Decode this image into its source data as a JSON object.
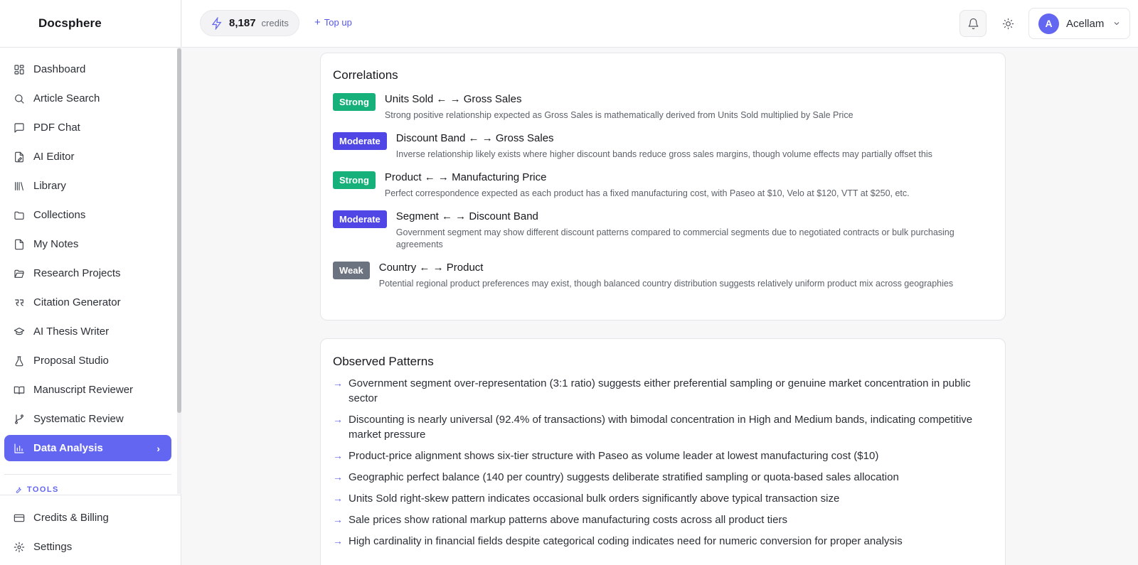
{
  "brand": "Docsphere",
  "sidebar": {
    "items": [
      {
        "label": "Dashboard",
        "icon": "dashboard-icon"
      },
      {
        "label": "Article Search",
        "icon": "search-icon"
      },
      {
        "label": "PDF Chat",
        "icon": "chat-icon"
      },
      {
        "label": "AI Editor",
        "icon": "edit-file-icon"
      },
      {
        "label": "Library",
        "icon": "library-icon"
      },
      {
        "label": "Collections",
        "icon": "folder-icon"
      },
      {
        "label": "My Notes",
        "icon": "note-icon"
      },
      {
        "label": "Research Projects",
        "icon": "folder-open-icon"
      },
      {
        "label": "Citation Generator",
        "icon": "quote-icon"
      },
      {
        "label": "AI Thesis Writer",
        "icon": "graduation-cap-icon"
      },
      {
        "label": "Proposal Studio",
        "icon": "flask-icon"
      },
      {
        "label": "Manuscript Reviewer",
        "icon": "book-open-icon"
      },
      {
        "label": "Systematic Review",
        "icon": "git-branch-icon"
      },
      {
        "label": "Data Analysis",
        "icon": "bar-chart-icon",
        "active": true
      }
    ],
    "tools_label": "TOOLS",
    "bottom_items": [
      {
        "label": "Credits & Billing",
        "icon": "credit-card-icon"
      },
      {
        "label": "Settings",
        "icon": "gear-icon"
      }
    ]
  },
  "topbar": {
    "credits_value": "8,187",
    "credits_unit": "credits",
    "topup_label": "Top up",
    "user_initial": "A",
    "user_name": "Acellam"
  },
  "correlations": {
    "title": "Correlations",
    "items": [
      {
        "strength": "Strong",
        "pair": "Units Sold ← → Gross Sales",
        "desc": "Strong positive relationship expected as Gross Sales is mathematically derived from Units Sold multiplied by Sale Price"
      },
      {
        "strength": "Moderate",
        "pair": "Discount Band ← → Gross Sales",
        "desc": "Inverse relationship likely exists where higher discount bands reduce gross sales margins, though volume effects may partially offset this"
      },
      {
        "strength": "Strong",
        "pair": "Product ← → Manufacturing Price",
        "desc": "Perfect correspondence expected as each product has a fixed manufacturing cost, with Paseo at $10, Velo at $120, VTT at $250, etc."
      },
      {
        "strength": "Moderate",
        "pair": "Segment ← → Discount Band",
        "desc": "Government segment may show different discount patterns compared to commercial segments due to negotiated contracts or bulk purchasing agreements"
      },
      {
        "strength": "Weak",
        "pair": "Country ← → Product",
        "desc": "Potential regional product preferences may exist, though balanced country distribution suggests relatively uniform product mix across geographies"
      }
    ]
  },
  "patterns": {
    "title": "Observed Patterns",
    "items": [
      "Government segment over-representation (3:1 ratio) suggests either preferential sampling or genuine market concentration in public sector",
      "Discounting is nearly universal (92.4% of transactions) with bimodal concentration in High and Medium bands, indicating competitive market pressure",
      "Product-price alignment shows six-tier structure with Paseo as volume leader at lowest manufacturing cost ($10)",
      "Geographic perfect balance (140 per country) suggests deliberate stratified sampling or quota-based sales allocation",
      "Units Sold right-skew pattern indicates occasional bulk orders significantly above typical transaction size",
      "Sale prices show rational markup patterns above manufacturing costs across all product tiers",
      "High cardinality in financial fields despite categorical coding indicates need for numeric conversion for proper analysis"
    ]
  }
}
